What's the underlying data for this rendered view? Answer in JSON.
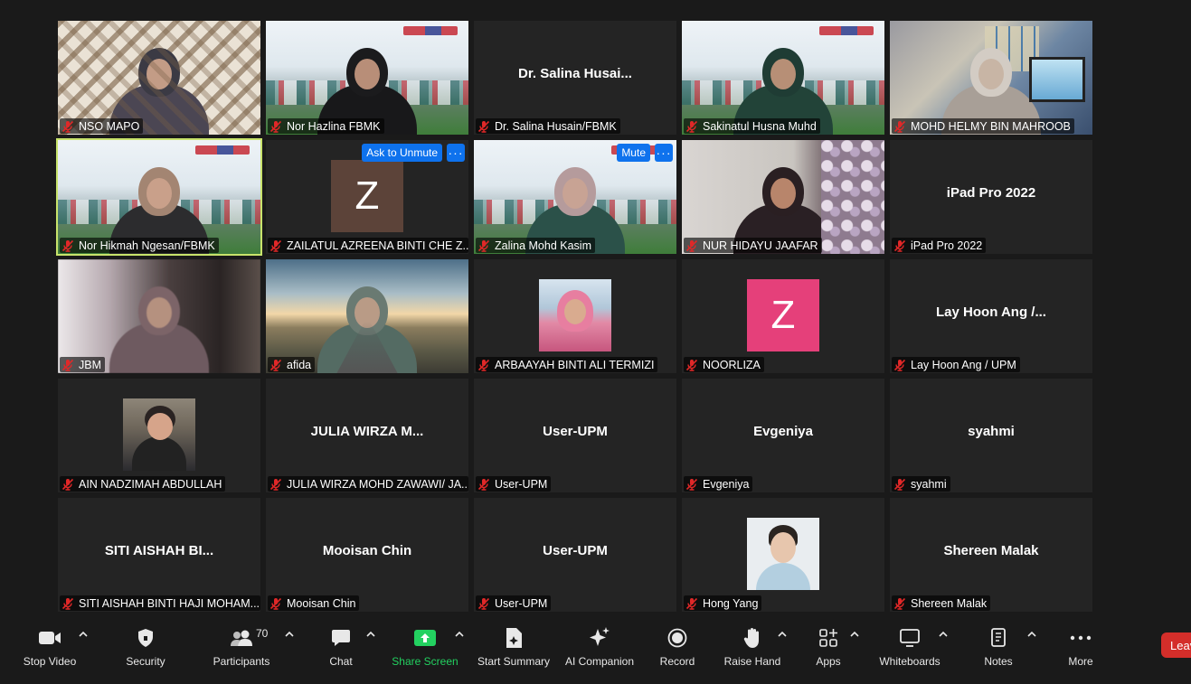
{
  "tiles": [
    {
      "name": "NSO MAPO",
      "type": "video",
      "bg": "zigzag",
      "skin": "#c39c86",
      "head": "#3b3a44",
      "body": "#4b4653"
    },
    {
      "name": "Nor Hazlina FBMK",
      "type": "video",
      "bg": "campus",
      "skin": "#b88e78",
      "head": "#1b1b1d",
      "body": "#18181a"
    },
    {
      "name": "Dr. Salina Husain/FBMK",
      "type": "name",
      "display": "Dr. Salina  Husai..."
    },
    {
      "name": "Sakinatul Husna Muhd",
      "type": "video",
      "bg": "campus",
      "skin": "#b78f76",
      "head": "#1f3c34",
      "body": "#224338"
    },
    {
      "name": "MOHD HELMY BIN MAHROOB",
      "type": "video",
      "bg": "office",
      "skin": "#c8b5a5",
      "head": "#d3ccc4",
      "body": "#a89f97"
    },
    {
      "name": "Nor Hikmah Ngesan/FBMK",
      "type": "video",
      "bg": "campus",
      "skin": "#c9a08a",
      "head": "#a38572",
      "body": "#2c2c2e",
      "active": true
    },
    {
      "name": "ZAILATUL AZREENA BINTI CHE Z...",
      "type": "avatar",
      "initial": "Z",
      "color": "#5c4339",
      "pill": "Ask to Unmute"
    },
    {
      "name": "Zalina Mohd Kasim",
      "type": "video",
      "bg": "campus",
      "skin": "#c8a394",
      "head": "#b59b9c",
      "body": "#2b5149",
      "pill": "Mute"
    },
    {
      "name": "NUR HIDAYU JAAFAR",
      "type": "video",
      "bg": "room",
      "skin": "#b8856b",
      "head": "#2a1f22",
      "body": "#2a2024"
    },
    {
      "name": "iPad Pro 2022",
      "type": "name",
      "display": "iPad Pro 2022"
    },
    {
      "name": "JBM",
      "type": "video",
      "bg": "blur",
      "skin": "#b5917f",
      "head": "#7c6468",
      "body": "#6e5a60"
    },
    {
      "name": "afida",
      "type": "video",
      "bg": "sky",
      "skin": "#b99b86",
      "head": "#6a7a72",
      "body": "#546b63"
    },
    {
      "name": "ARBAAYAH BINTI ALI TERMIZI",
      "type": "photo",
      "photo": "pink"
    },
    {
      "name": "NOORLIZA",
      "type": "avatar",
      "initial": "Z",
      "color": "#e5407a"
    },
    {
      "name": "Lay Hoon Ang / UPM",
      "type": "name",
      "display": "Lay Hoon Ang /..."
    },
    {
      "name": "AIN NADZIMAH ABDULLAH",
      "type": "photo",
      "photo": "dark"
    },
    {
      "name": "JULIA WIRZA MOHD ZAWAWI/ JA...",
      "type": "name",
      "display": "JULIA WIRZA M..."
    },
    {
      "name": "User-UPM",
      "type": "name",
      "display": "User-UPM"
    },
    {
      "name": "Evgeniya",
      "type": "name",
      "display": "Evgeniya"
    },
    {
      "name": "syahmi",
      "type": "name",
      "display": "syahmi"
    },
    {
      "name": "SITI AISHAH BINTI HAJI MOHAM...",
      "type": "name",
      "display": "SITI AISHAH BI..."
    },
    {
      "name": "Mooisan Chin",
      "type": "name",
      "display": "Mooisan Chin"
    },
    {
      "name": "User-UPM",
      "type": "name",
      "display": "User-UPM"
    },
    {
      "name": "Hong Yang",
      "type": "photo",
      "photo": "light"
    },
    {
      "name": "Shereen Malak",
      "type": "name",
      "display": "Shereen Malak"
    }
  ],
  "pill_more": "···",
  "toolbar": {
    "stop_video": "Stop Video",
    "security": "Security",
    "participants": "Participants",
    "participant_count": "70",
    "chat": "Chat",
    "share_screen": "Share Screen",
    "start_summary": "Start Summary",
    "ai_companion": "AI Companion",
    "record": "Record",
    "raise_hand": "Raise Hand",
    "apps": "Apps",
    "whiteboards": "Whiteboards",
    "notes": "Notes",
    "more": "More",
    "leave": "Leave"
  },
  "colors": {
    "background": "#1a1a1a",
    "tile": "#242424",
    "active_outline": "#c8e36b",
    "pill": "#0e72ed",
    "mic_muted": "#e02828",
    "share_green": "#23d160",
    "leave_red": "#d42e2a"
  }
}
